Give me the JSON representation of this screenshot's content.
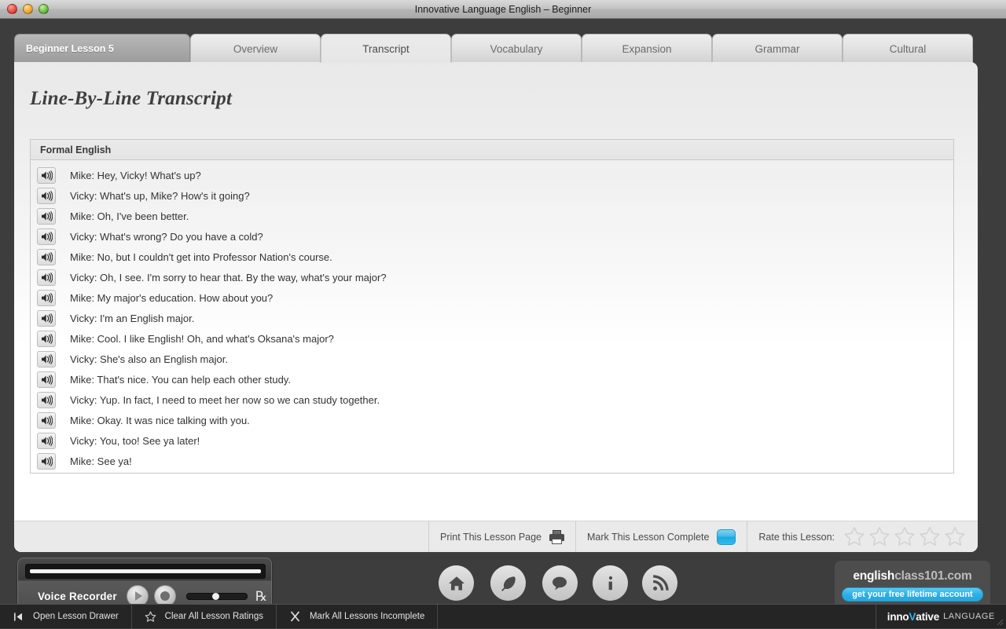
{
  "window": {
    "title": "Innovative Language English – Beginner",
    "traffic_lights": [
      "close-red",
      "minimize-amber",
      "zoom-green"
    ]
  },
  "tabs": [
    {
      "label": "Beginner Lesson 5",
      "kind": "lesson",
      "active": false
    },
    {
      "label": "Overview",
      "kind": "tab",
      "active": false
    },
    {
      "label": "Transcript",
      "kind": "tab",
      "active": true
    },
    {
      "label": "Vocabulary",
      "kind": "tab",
      "active": false
    },
    {
      "label": "Expansion",
      "kind": "tab",
      "active": false
    },
    {
      "label": "Grammar",
      "kind": "tab",
      "active": false
    },
    {
      "label": "Cultural",
      "kind": "tab",
      "active": false
    }
  ],
  "page": {
    "title": "Line-By-Line Transcript",
    "section_header": "Formal English",
    "lines": [
      {
        "speaker": "Mike",
        "text": "Mike: Hey, Vicky! What's up?"
      },
      {
        "speaker": "Vicky",
        "text": "Vicky: What's up, Mike? How's it going?"
      },
      {
        "speaker": "Mike",
        "text": "Mike: Oh, I've been better."
      },
      {
        "speaker": "Vicky",
        "text": "Vicky: What's wrong? Do you have a cold?"
      },
      {
        "speaker": "Mike",
        "text": "Mike: No, but I couldn't get into Professor Nation's course."
      },
      {
        "speaker": "Vicky",
        "text": "Vicky: Oh, I see. I'm sorry to hear that. By the way, what's your major?"
      },
      {
        "speaker": "Mike",
        "text": "Mike: My major's education. How about you?"
      },
      {
        "speaker": "Vicky",
        "text": "Vicky: I'm an English major."
      },
      {
        "speaker": "Mike",
        "text": "Mike: Cool. I like English! Oh, and what's Oksana's major?"
      },
      {
        "speaker": "Vicky",
        "text": "Vicky: She's also an English major."
      },
      {
        "speaker": "Mike",
        "text": "Mike: That's nice. You can help each other study."
      },
      {
        "speaker": "Vicky",
        "text": "Vicky: Yup. In fact, I need to meet her now so we can study together."
      },
      {
        "speaker": "Mike",
        "text": "Mike: Okay. It was nice talking with you."
      },
      {
        "speaker": "Vicky",
        "text": "Vicky: You, too! See ya later!"
      },
      {
        "speaker": "Mike",
        "text": "Mike: See ya!"
      }
    ]
  },
  "panel_footer": {
    "print_label": "Print This Lesson Page",
    "print_icon": "printer-icon",
    "mark_complete_label": "Mark This Lesson Complete",
    "mark_complete_checked": true,
    "rate_label": "Rate this Lesson:",
    "rating_value": 0,
    "rating_max": 5
  },
  "recorder": {
    "label": "Voice Recorder",
    "play_icon": "play-icon",
    "record_icon": "record-icon",
    "volume_icon": "volume-icon",
    "volume_value": 42
  },
  "icon_nav": [
    {
      "label": "Start Page",
      "icon": "home-icon"
    },
    {
      "label": "Reference",
      "icon": "feather-icon"
    },
    {
      "label": "Feedback",
      "icon": "speech-bubble-icon"
    },
    {
      "label": "About Us",
      "icon": "info-icon"
    },
    {
      "label": "News",
      "icon": "rss-icon"
    }
  ],
  "brand": {
    "name_bold": "english",
    "name_rest": "class101.com",
    "cta": "get your free lifetime account",
    "accent": "#2bafe6"
  },
  "statusbar": {
    "items": [
      {
        "label": "Open Lesson Drawer",
        "icon": "drawer-icon"
      },
      {
        "label": "Clear All Lesson Ratings",
        "icon": "star-outline-icon"
      },
      {
        "label": "Mark All Lessons Incomplete",
        "icon": "x-icon"
      }
    ],
    "logo_pre": "inno",
    "logo_v": "V",
    "logo_post": "ative",
    "logo_suffix": "LANGUAGE"
  }
}
